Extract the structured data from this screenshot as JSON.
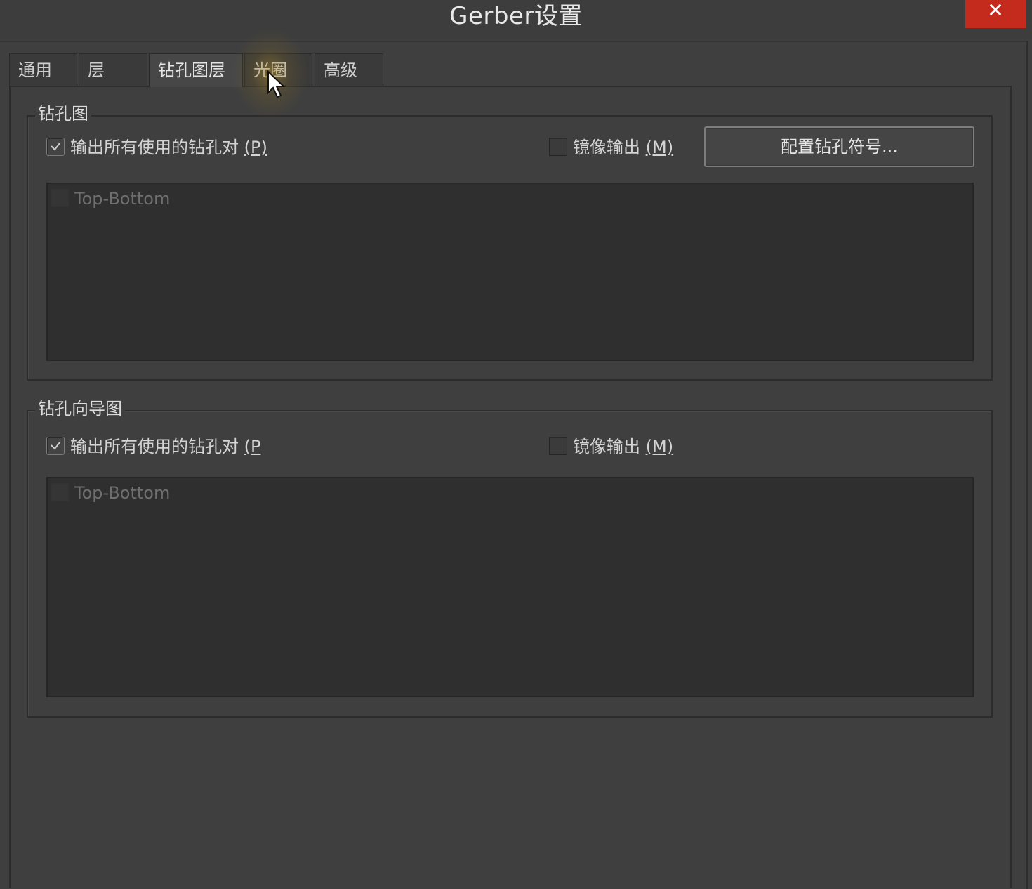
{
  "window": {
    "title": "Gerber设置",
    "close_label": "✕"
  },
  "tabs": [
    {
      "label": "通用",
      "active": false
    },
    {
      "label": "层",
      "active": false
    },
    {
      "label": "钻孔图层",
      "active": true
    },
    {
      "label": "光圈",
      "active": false
    },
    {
      "label": "高级",
      "active": false
    }
  ],
  "drill_drawing": {
    "group_label": "钻孔图",
    "output_all_pairs": {
      "label": "输出所有使用的钻孔对 ",
      "mnemonic": "(P)",
      "checked": true
    },
    "mirror_output": {
      "label": "镜像输出 ",
      "mnemonic": "(M)",
      "checked": false
    },
    "config_button_label": "配置钻孔符号...",
    "list_items": [
      {
        "label": "Top-Bottom",
        "checked": false
      }
    ]
  },
  "drill_guide": {
    "group_label": "钻孔向导图",
    "output_all_pairs": {
      "label": "输出所有使用的钻孔对 ",
      "mnemonic": "(P",
      "checked": true
    },
    "mirror_output": {
      "label": "镜像输出 ",
      "mnemonic": "(M)",
      "checked": false
    },
    "list_items": [
      {
        "label": "Top-Bottom",
        "checked": false
      }
    ]
  },
  "colors": {
    "background": "#3f3f3f",
    "close_button": "#c42b1c",
    "listbox": "#2f2f2f"
  }
}
